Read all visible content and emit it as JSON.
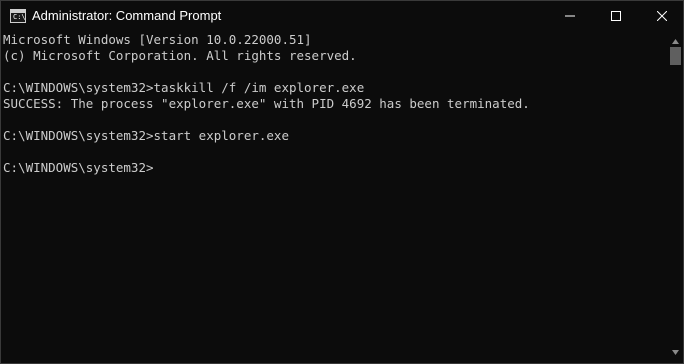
{
  "window": {
    "title": "Administrator: Command Prompt",
    "app_icon": "cmd-icon",
    "app_icon_text": "C:\\",
    "controls": {
      "minimize": "minimize-icon",
      "maximize": "maximize-icon",
      "close": "close-icon"
    }
  },
  "console": {
    "lines": [
      "Microsoft Windows [Version 10.0.22000.51]",
      "(c) Microsoft Corporation. All rights reserved.",
      "",
      "C:\\WINDOWS\\system32>taskkill /f /im explorer.exe",
      "SUCCESS: The process \"explorer.exe\" with PID 4692 has been terminated.",
      "",
      "C:\\WINDOWS\\system32>start explorer.exe",
      "",
      "C:\\WINDOWS\\system32>"
    ]
  },
  "colors": {
    "background": "#0c0c0c",
    "text": "#cccccc",
    "title_text": "#ffffff",
    "scroll_thumb": "#5f5f5f"
  }
}
